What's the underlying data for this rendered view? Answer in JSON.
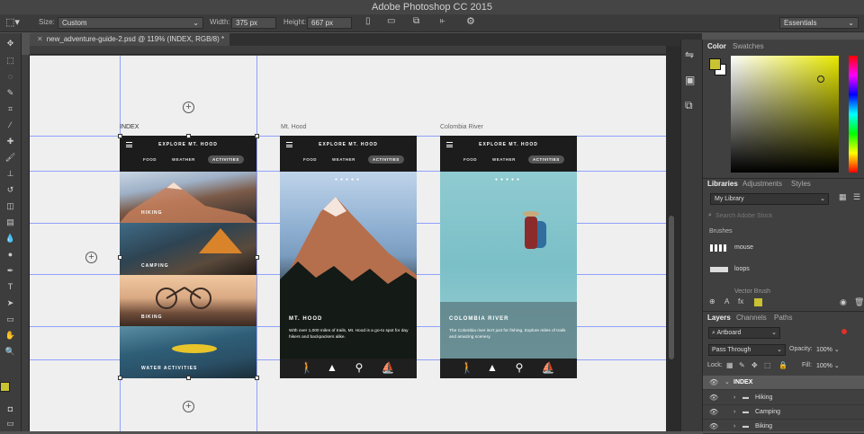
{
  "app": {
    "title": "Adobe Photoshop CC 2015"
  },
  "options_bar": {
    "size_label": "Size:",
    "size_value": "Custom",
    "width_label": "Width:",
    "width_value": "375 px",
    "height_label": "Height:",
    "height_value": "667 px",
    "workspace": "Essentials"
  },
  "document": {
    "tab_label": "new_adventure-guide-2.psd @ 119% (INDEX, RGB/8) *"
  },
  "artboards": {
    "index": {
      "label": "INDEX",
      "header_title": "EXPLORE MT. HOOD",
      "nav": [
        "FOOD",
        "WEATHER",
        "ACTIVITIES"
      ],
      "tiles": [
        "HIKING",
        "CAMPING",
        "BIKING",
        "WATER ACTIVITIES"
      ]
    },
    "mthood": {
      "label": "Mt. Hood",
      "header_title": "EXPLORE MT. HOOD",
      "nav": [
        "FOOD",
        "WEATHER",
        "ACTIVITIES"
      ],
      "heading": "MT. HOOD",
      "body": "With over 1,000 miles of trails, Mt. Hood is a go-to spot for day hikers and backpackers alike."
    },
    "colombia": {
      "label": "Colombia River",
      "header_title": "EXPLORE MT. HOOD",
      "nav": [
        "FOOD",
        "WEATHER",
        "ACTIVITIES"
      ],
      "heading": "COLOMBIA RIVER",
      "body": "The Colombia river isn't just for fishing. Explore miles of trails and amazing scenery."
    }
  },
  "color_panel": {
    "tabs": [
      "Color",
      "Swatches"
    ],
    "fg": "#c9c233",
    "bg": "#ffffff"
  },
  "libraries_panel": {
    "tabs": [
      "Libraries",
      "Adjustments",
      "Styles"
    ],
    "library_name": "My Library",
    "search_placeholder": "Search Adobe Stock",
    "section": "Brushes",
    "items": [
      "mouse",
      "loops",
      "Vector Brush"
    ]
  },
  "layers_panel": {
    "tabs": [
      "Layers",
      "Channels",
      "Paths"
    ],
    "filter": "Artboard",
    "blend_mode": "Pass Through",
    "opacity_label": "Opacity:",
    "opacity": "100%",
    "lock_label": "Lock:",
    "fill_label": "Fill:",
    "fill": "100%",
    "layers": [
      "INDEX",
      "Hiking",
      "Camping",
      "Biking"
    ]
  }
}
